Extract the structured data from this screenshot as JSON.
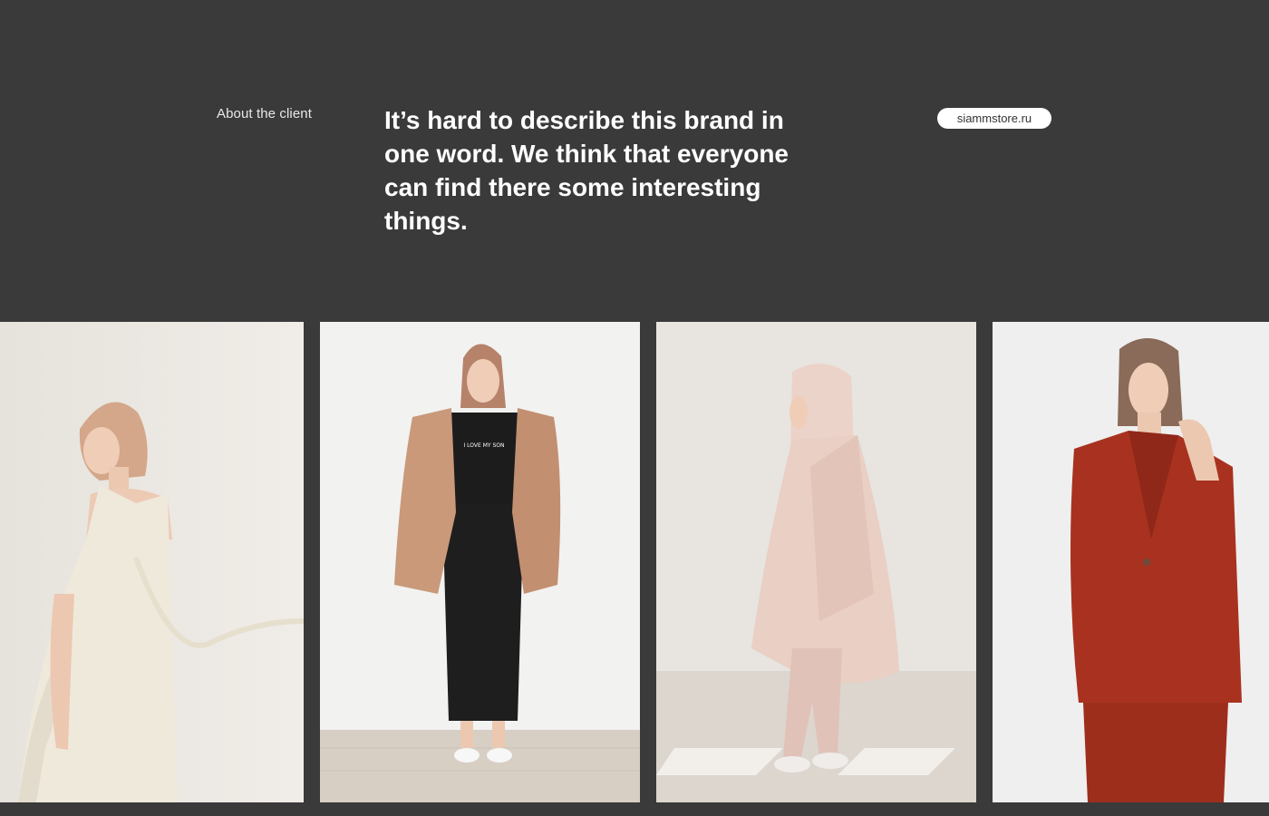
{
  "about": {
    "label": "About the client",
    "headline": "It’s hard to describe this brand in one word. We think that everyone can find there some interesting things.",
    "site_link": "siammstore.ru"
  },
  "gallery": {
    "photos": [
      {
        "subject": "model-white-dress",
        "background": "#ece8e3",
        "garment_color": "#efe9dc"
      },
      {
        "subject": "model-tan-jacket-black-skirt",
        "background": "#efefef",
        "garment_color": "#c9997a",
        "shirt_text": "I LOVE MY SON"
      },
      {
        "subject": "model-pink-hooded-coat",
        "background": "#e7e3de",
        "garment_color": "#e9cfc4"
      },
      {
        "subject": "model-red-suit",
        "background": "#f1f1f1",
        "garment_color": "#a8321f"
      }
    ]
  },
  "colors": {
    "background": "#3a3a3a",
    "text": "#ffffff",
    "pill_bg": "#ffffff",
    "pill_text": "#333333"
  }
}
